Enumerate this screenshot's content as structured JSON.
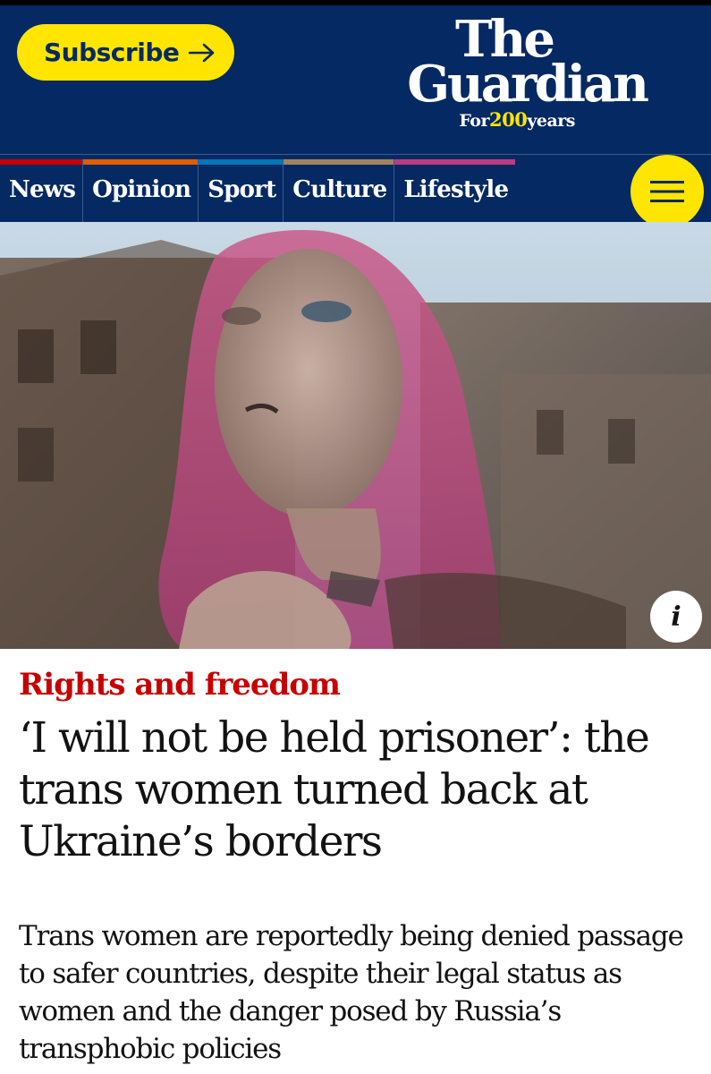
{
  "header": {
    "subscribe_label": "Subscribe",
    "logo": {
      "line1": "The",
      "line2": "Guardian",
      "tagline_prefix": "For",
      "tagline_number": "200",
      "tagline_suffix": "years"
    }
  },
  "nav": {
    "items": [
      {
        "label": "News",
        "color": "#c70000"
      },
      {
        "label": "Opinion",
        "color": "#e05e00"
      },
      {
        "label": "Sport",
        "color": "#0077b6"
      },
      {
        "label": "Culture",
        "color": "#a1845c"
      },
      {
        "label": "Lifestyle",
        "color": "#bb3b80"
      }
    ],
    "menu_icon": "hamburger-icon"
  },
  "hero": {
    "info_label": "i"
  },
  "article": {
    "kicker": "Rights and freedom",
    "headline": "‘I will not be held prisoner’: the trans women turned back at Ukraine’s borders",
    "standfirst": "Trans women are reportedly being denied passage to safer countries, despite their legal status as women and the danger posed by Russia’s transphobic policies"
  },
  "colors": {
    "brand_blue": "#052962",
    "accent_yellow": "#ffe500",
    "kicker_red": "#c70000"
  }
}
